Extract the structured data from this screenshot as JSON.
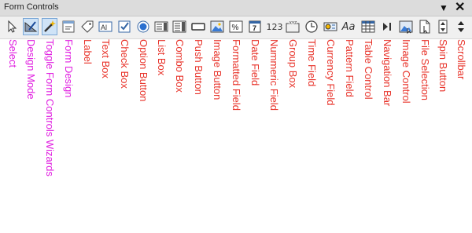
{
  "window": {
    "title": "Form Controls",
    "menu_icon": "chevron-down-icon",
    "close_icon": "close-icon"
  },
  "colors": {
    "magenta": "#e020e0",
    "red": "#e8332a"
  },
  "tools": [
    {
      "label": "Select",
      "icon": "pointer-icon",
      "group": "magenta"
    },
    {
      "label": "Design Mode",
      "icon": "design-mode-icon",
      "group": "magenta"
    },
    {
      "label": "Toggle Form Controls Wizards",
      "icon": "wand-icon",
      "group": "magenta"
    },
    {
      "label": "Form Design",
      "icon": "form-design-icon",
      "group": "magenta"
    },
    {
      "label": "Label",
      "icon": "tag-icon",
      "group": "red"
    },
    {
      "label": "Text Box",
      "icon": "textbox-icon",
      "group": "red"
    },
    {
      "label": "Check Box",
      "icon": "checkbox-icon",
      "group": "red"
    },
    {
      "label": "Option Button",
      "icon": "radio-icon",
      "group": "red"
    },
    {
      "label": "List Box",
      "icon": "listbox-icon",
      "group": "red"
    },
    {
      "label": "Combo Box",
      "icon": "combobox-icon",
      "group": "red"
    },
    {
      "label": "Push Button",
      "icon": "push-button-icon",
      "group": "red"
    },
    {
      "label": "Image Button",
      "icon": "image-button-icon",
      "group": "red"
    },
    {
      "label": "Formatted Field",
      "icon": "percent-icon",
      "group": "red"
    },
    {
      "label": "Date Field",
      "icon": "calendar-icon",
      "group": "red",
      "icon_text": "7"
    },
    {
      "label": "Nummeric Field",
      "icon": "numeric-icon",
      "group": "red",
      "icon_text": "123"
    },
    {
      "label": "Group Box",
      "icon": "group-box-icon",
      "group": "red",
      "icon_text": "XYZ"
    },
    {
      "label": "Time Field",
      "icon": "clock-icon",
      "group": "red"
    },
    {
      "label": "Currency Field",
      "icon": "currency-icon",
      "group": "red"
    },
    {
      "label": "Pattern Field",
      "icon": "pattern-icon",
      "group": "red",
      "icon_text": "Aa"
    },
    {
      "label": "Table Control",
      "icon": "table-icon",
      "group": "red"
    },
    {
      "label": "Navigation Bar",
      "icon": "navigation-icon",
      "group": "red"
    },
    {
      "label": "Image Control",
      "icon": "image-control-icon",
      "group": "red"
    },
    {
      "label": "File Selection",
      "icon": "file-selection-icon",
      "group": "red"
    },
    {
      "label": "Spin Button",
      "icon": "spin-icon",
      "group": "red"
    },
    {
      "label": "Scrollbar",
      "icon": "scrollbar-icon",
      "group": "red"
    }
  ]
}
